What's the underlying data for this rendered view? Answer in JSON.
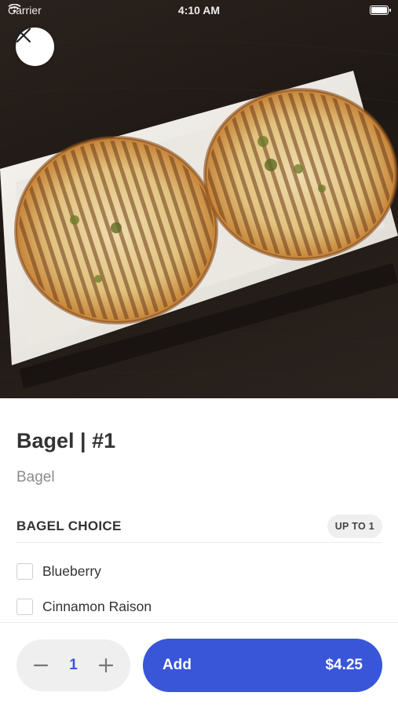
{
  "status_bar": {
    "carrier": "Carrier",
    "time": "4:10 AM"
  },
  "item": {
    "title": "Bagel | #1",
    "subtitle": "Bagel"
  },
  "section": {
    "title": "BAGEL CHOICE",
    "badge": "UP TO 1",
    "options": [
      {
        "label": "Blueberry",
        "checked": false
      },
      {
        "label": "Cinnamon Raison",
        "checked": false
      }
    ]
  },
  "order": {
    "quantity": "1",
    "add_label": "Add",
    "price": "$4.25"
  },
  "colors": {
    "accent": "#3955d8",
    "quantity_text": "#3a56d6"
  },
  "icons": {
    "close": "close-icon",
    "minus": "minus-icon",
    "plus": "plus-icon",
    "wifi": "wifi-icon",
    "battery": "battery-icon"
  }
}
